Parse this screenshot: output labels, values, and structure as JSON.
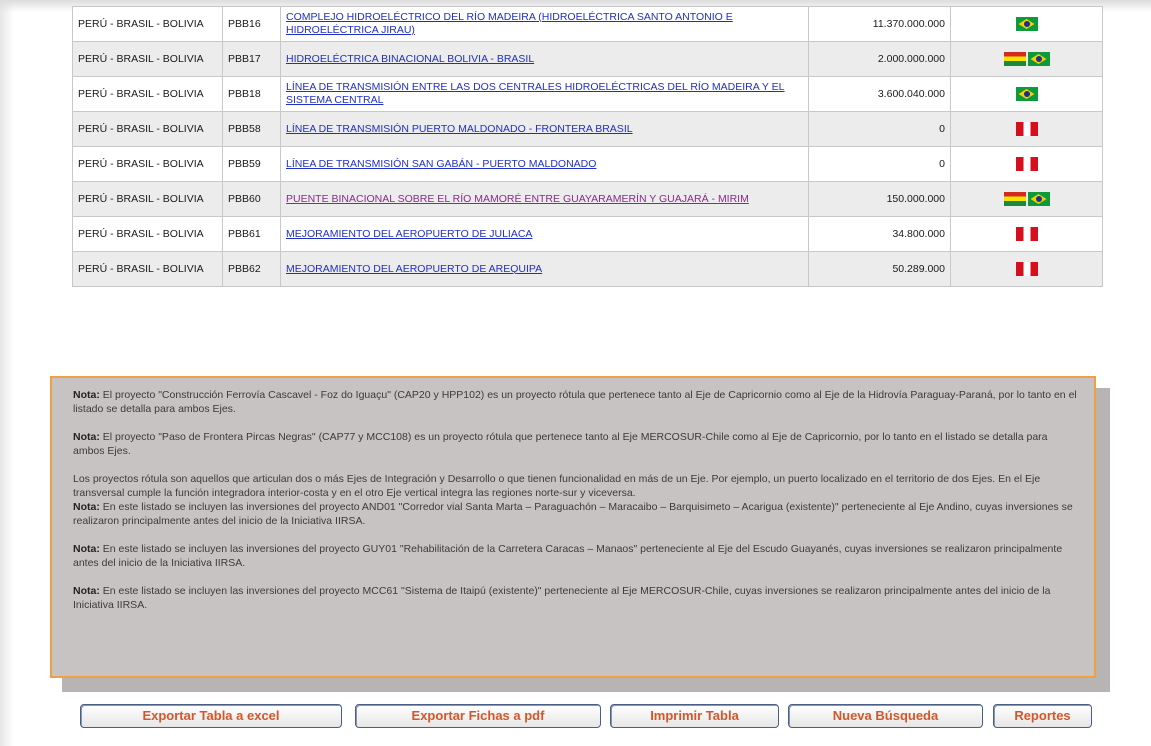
{
  "projects": [
    {
      "axis": "PERÚ - BRASIL - BOLIVIA",
      "code": "PBB16",
      "name": "COMPLEJO HIDROELÉCTRICO DEL RÍO MADEIRA (HIDROELÉCTRICA SANTO ANTONIO E HIDROELÉCTRICA JIRAU)",
      "amount": "11.370.000.000",
      "flags": [
        "brazil-flag-icon"
      ]
    },
    {
      "axis": "PERÚ - BRASIL - BOLIVIA",
      "code": "PBB17",
      "name": "HIDROELÉCTRICA BINACIONAL BOLIVIA - BRASIL",
      "amount": "2.000.000.000",
      "flags": [
        "bolivia-flag-icon",
        "brazil-flag-icon"
      ]
    },
    {
      "axis": "PERÚ - BRASIL - BOLIVIA",
      "code": "PBB18",
      "name": "LÍNEA DE TRANSMISIÓN ENTRE LAS DOS CENTRALES HIDROELÉCTRICAS DEL RÍO MADEIRA Y EL SISTEMA CENTRAL",
      "amount": "3.600.040.000",
      "flags": [
        "brazil-flag-icon"
      ]
    },
    {
      "axis": "PERÚ - BRASIL - BOLIVIA",
      "code": "PBB58",
      "name": "LÍNEA DE TRANSMISIÓN PUERTO MALDONADO - FRONTERA BRASIL",
      "amount": "0",
      "flags": [
        "peru-flag-icon"
      ]
    },
    {
      "axis": "PERÚ - BRASIL - BOLIVIA",
      "code": "PBB59",
      "name": "LÍNEA DE TRANSMISIÓN SAN GABÁN - PUERTO MALDONADO",
      "amount": "0",
      "flags": [
        "peru-flag-icon"
      ]
    },
    {
      "axis": "PERÚ - BRASIL - BOLIVIA",
      "code": "PBB60",
      "name": "PUENTE BINACIONAL SOBRE EL RÍO MAMORÉ ENTRE GUAYARAMERÍN Y GUAJARÁ - MIRIM",
      "amount": "150.000.000",
      "flags": [
        "bolivia-flag-icon",
        "brazil-flag-icon"
      ]
    },
    {
      "axis": "PERÚ - BRASIL - BOLIVIA",
      "code": "PBB61",
      "name": "MEJORAMIENTO DEL AEROPUERTO DE JULIACA",
      "amount": "34.800.000",
      "flags": [
        "peru-flag-icon"
      ]
    },
    {
      "axis": "PERÚ - BRASIL - BOLIVIA",
      "code": "PBB62",
      "name": "MEJORAMIENTO DEL AEROPUERTO DE AREQUIPA",
      "amount": "50.289.000",
      "flags": [
        "peru-flag-icon"
      ]
    }
  ],
  "notes": {
    "label": "Nota:",
    "note1": "El proyecto \"Construcción Ferrovía Cascavel - Foz do Iguaçu\" (CAP20 y HPP102) es un proyecto rótula que pertenece tanto al Eje de Capricornio como al Eje de la Hidrovía Paraguay-Paraná, por lo tanto en el listado se detalla para ambos Ejes.",
    "note2": "El proyecto \"Paso de Frontera Pircas Negras\" (CAP77 y MCC108) es un proyecto rótula que pertenece tanto al Eje MERCOSUR-Chile como al Eje de Capricornio, por lo tanto en el listado se detalla para ambos Ejes.",
    "rotula": "Los proyectos rótula son aquellos que articulan dos o más Ejes de Integración y Desarrollo o que tienen funcionalidad en más de un Eje. Por ejemplo, un puerto localizado en el territorio de dos Ejes. En el Eje transversal cumple la función integradora interior-costa y en el otro Eje vertical integra las regiones norte-sur y viceversa.",
    "note3": "En este listado se incluyen las inversiones del proyecto AND01 \"Corredor vial Santa Marta – Paraguachón – Maracaibo – Barquisimeto – Acarigua (existente)\" perteneciente al Eje Andino, cuyas inversiones se realizaron principalmente antes del inicio de la Iniciativa IIRSA.",
    "note4": "En este listado se incluyen las inversiones del proyecto GUY01 \"Rehabilitación de la Carretera Caracas – Manaos\" perteneciente al Eje del Escudo Guayanés, cuyas inversiones se realizaron principalmente antes del inicio de la Iniciativa IIRSA.",
    "note5": "En este listado se incluyen las inversiones del proyecto MCC61 \"Sistema de Itaipú (existente)\" perteneciente al Eje MERCOSUR-Chile, cuyas inversiones se realizaron principalmente antes del inicio de la Iniciativa IIRSA."
  },
  "buttons": {
    "export_excel": "Exportar Tabla a excel",
    "export_pdf": "Exportar Fichas a pdf",
    "print": "Imprimir Tabla",
    "new_search": "Nueva Búsqueda",
    "reports": "Reportes"
  },
  "colors": {
    "link": "#1f2fc8",
    "visited_link": "#8a2a8a",
    "notes_border": "#f0a043",
    "button_text": "#d4572a"
  }
}
